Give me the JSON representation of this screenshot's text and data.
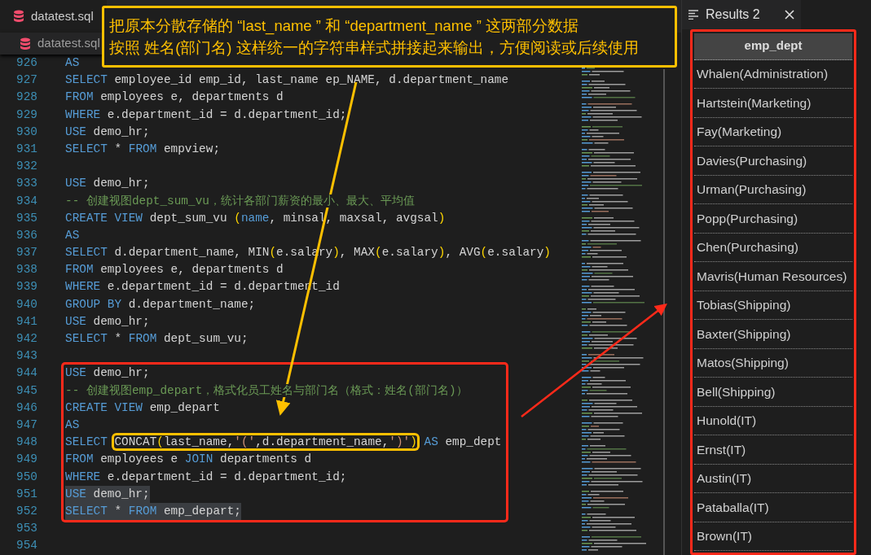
{
  "editor_tabs": [
    {
      "label": "datatest.sql",
      "selected": true
    }
  ],
  "breadcrumb": {
    "label": "datatest.sql"
  },
  "callout": {
    "lines": [
      "把原本分散存储的 “last_name ” 和 “department_name ” 这两部分数据",
      "按照 姓名(部门名) 这样统一的字符串样式拼接起来输出，方便阅读或后续使用"
    ]
  },
  "code": {
    "blocks": [
      {
        "framed": false,
        "lines": [
          {
            "number": "926",
            "selected": false,
            "tokens": [
              {
                "kind": "keyword",
                "text": "AS"
              }
            ]
          },
          {
            "number": "927",
            "selected": false,
            "tokens": [
              {
                "kind": "keyword",
                "text": "SELECT"
              },
              {
                "kind": "plain",
                "text": " employee_id emp_id, last_name ep_NAME, d.department_name"
              }
            ]
          },
          {
            "number": "928",
            "selected": false,
            "tokens": [
              {
                "kind": "keyword",
                "text": "FROM"
              },
              {
                "kind": "plain",
                "text": " employees e, departments d"
              }
            ]
          },
          {
            "number": "929",
            "selected": false,
            "tokens": [
              {
                "kind": "keyword",
                "text": "WHERE"
              },
              {
                "kind": "plain",
                "text": " e.department_id = d.department_id;"
              }
            ]
          },
          {
            "number": "930",
            "selected": false,
            "tokens": [
              {
                "kind": "keyword",
                "text": "USE"
              },
              {
                "kind": "plain",
                "text": " demo_hr;"
              }
            ]
          },
          {
            "number": "931",
            "selected": false,
            "tokens": [
              {
                "kind": "keyword",
                "text": "SELECT"
              },
              {
                "kind": "plain",
                "text": " * "
              },
              {
                "kind": "keyword",
                "text": "FROM"
              },
              {
                "kind": "plain",
                "text": " empview;"
              }
            ]
          },
          {
            "number": "932",
            "selected": false
          },
          {
            "number": "933",
            "selected": false,
            "tokens": [
              {
                "kind": "keyword",
                "text": "USE"
              },
              {
                "kind": "plain",
                "text": " demo_hr;"
              }
            ]
          },
          {
            "number": "934",
            "selected": false,
            "tokens": [
              {
                "kind": "comment",
                "text": "-- 创建视图dept_sum_vu，统计各部门薪资的最小、最大、平均值"
              }
            ]
          },
          {
            "number": "935",
            "selected": false,
            "tokens": [
              {
                "kind": "keyword",
                "text": "CREATE VIEW"
              },
              {
                "kind": "plain",
                "text": " dept_sum_vu "
              },
              {
                "kind": "bracket",
                "text": "("
              },
              {
                "kind": "keyword",
                "text": "name"
              },
              {
                "kind": "plain",
                "text": ", minsal, maxsal, avgsal"
              },
              {
                "kind": "bracket",
                "text": ")"
              }
            ]
          },
          {
            "number": "936",
            "selected": false,
            "tokens": [
              {
                "kind": "keyword",
                "text": "AS"
              }
            ]
          },
          {
            "number": "937",
            "selected": false,
            "tokens": [
              {
                "kind": "keyword",
                "text": "SELECT"
              },
              {
                "kind": "plain",
                "text": " d.department_name, MIN"
              },
              {
                "kind": "bracket",
                "text": "("
              },
              {
                "kind": "plain",
                "text": "e.salary"
              },
              {
                "kind": "bracket",
                "text": ")"
              },
              {
                "kind": "plain",
                "text": ", MAX"
              },
              {
                "kind": "bracket",
                "text": "("
              },
              {
                "kind": "plain",
                "text": "e.salary"
              },
              {
                "kind": "bracket",
                "text": ")"
              },
              {
                "kind": "plain",
                "text": ", AVG"
              },
              {
                "kind": "bracket",
                "text": "("
              },
              {
                "kind": "plain",
                "text": "e.salary"
              },
              {
                "kind": "bracket",
                "text": ")"
              }
            ]
          },
          {
            "number": "938",
            "selected": false,
            "tokens": [
              {
                "kind": "keyword",
                "text": "FROM"
              },
              {
                "kind": "plain",
                "text": " employees e, departments d"
              }
            ]
          },
          {
            "number": "939",
            "selected": false,
            "tokens": [
              {
                "kind": "keyword",
                "text": "WHERE"
              },
              {
                "kind": "plain",
                "text": " e.department_id = d.department_id"
              }
            ]
          },
          {
            "number": "940",
            "selected": false,
            "tokens": [
              {
                "kind": "keyword",
                "text": "GROUP BY"
              },
              {
                "kind": "plain",
                "text": " d.department_name;"
              }
            ]
          },
          {
            "number": "941",
            "selected": false,
            "tokens": [
              {
                "kind": "keyword",
                "text": "USE"
              },
              {
                "kind": "plain",
                "text": " demo_hr;"
              }
            ]
          },
          {
            "number": "942",
            "selected": false,
            "tokens": [
              {
                "kind": "keyword",
                "text": "SELECT"
              },
              {
                "kind": "plain",
                "text": " * "
              },
              {
                "kind": "keyword",
                "text": "FROM"
              },
              {
                "kind": "plain",
                "text": " dept_sum_vu;"
              }
            ]
          },
          {
            "number": "943",
            "selected": false
          }
        ]
      },
      {
        "framed": true,
        "lines": [
          {
            "number": "944",
            "selected": false,
            "tokens": [
              {
                "kind": "keyword",
                "text": "USE"
              },
              {
                "kind": "plain",
                "text": " demo_hr;"
              }
            ]
          },
          {
            "number": "945",
            "selected": false,
            "tokens": [
              {
                "kind": "comment",
                "text": "-- 创建视图emp_depart，格式化员工姓名与部门名（格式：姓名(部门名)）"
              }
            ]
          },
          {
            "number": "946",
            "selected": false,
            "tokens": [
              {
                "kind": "keyword",
                "text": "CREATE VIEW"
              },
              {
                "kind": "plain",
                "text": " emp_depart"
              }
            ]
          },
          {
            "number": "947",
            "selected": false,
            "tokens": [
              {
                "kind": "keyword",
                "text": "AS"
              }
            ]
          },
          {
            "number": "948",
            "selected": false,
            "tokens": [
              {
                "kind": "keyword",
                "text": "SELECT"
              },
              {
                "kind": "group",
                "boxed": true,
                "tokens": [
                  {
                    "kind": "plain",
                    "text": "CONCAT"
                  },
                  {
                    "kind": "bracket",
                    "text": "("
                  },
                  {
                    "kind": "plain",
                    "text": "last_name,"
                  },
                  {
                    "kind": "string",
                    "text": "'('"
                  },
                  {
                    "kind": "plain",
                    "text": ",d.department_name,"
                  },
                  {
                    "kind": "string",
                    "text": "')'"
                  },
                  {
                    "kind": "bracket",
                    "text": ")"
                  }
                ]
              },
              {
                "kind": "keyword",
                "text": " AS"
              },
              {
                "kind": "plain",
                "text": " emp_dept"
              }
            ]
          },
          {
            "number": "949",
            "selected": false,
            "tokens": [
              {
                "kind": "keyword",
                "text": "FROM"
              },
              {
                "kind": "plain",
                "text": " employees e "
              },
              {
                "kind": "keyword",
                "text": "JOIN"
              },
              {
                "kind": "plain",
                "text": " departments d"
              }
            ]
          },
          {
            "number": "950",
            "selected": false,
            "tokens": [
              {
                "kind": "keyword",
                "text": "WHERE"
              },
              {
                "kind": "plain",
                "text": " e.department_id = d.department_id;"
              }
            ]
          },
          {
            "number": "951",
            "selected": true,
            "tokens": [
              {
                "kind": "keyword",
                "text": "USE"
              },
              {
                "kind": "plain",
                "text": " demo_hr;"
              }
            ]
          },
          {
            "number": "952",
            "selected": true,
            "tokens": [
              {
                "kind": "keyword",
                "text": "SELECT"
              },
              {
                "kind": "plain",
                "text": " * "
              },
              {
                "kind": "keyword",
                "text": "FROM"
              },
              {
                "kind": "plain",
                "text": " emp_depart;"
              }
            ]
          }
        ]
      },
      {
        "framed": false,
        "lines": [
          {
            "number": "953",
            "selected": false
          },
          {
            "number": "954",
            "selected": false
          }
        ]
      }
    ]
  },
  "results": {
    "tab": {
      "label": "Results 2",
      "selected": true
    },
    "table": {
      "columns": [
        "emp_dept"
      ],
      "rows": [
        "Whalen(Administration)",
        "Hartstein(Marketing)",
        "Fay(Marketing)",
        "Davies(Purchasing)",
        "Urman(Purchasing)",
        "Popp(Purchasing)",
        "Chen(Purchasing)",
        "Mavris(Human Resources)",
        "Tobias(Shipping)",
        "Baxter(Shipping)",
        "Matos(Shipping)",
        "Bell(Shipping)",
        "Hunold(IT)",
        "Ernst(IT)",
        "Austin(IT)",
        "Pataballa(IT)",
        "Brown(IT)"
      ]
    }
  }
}
